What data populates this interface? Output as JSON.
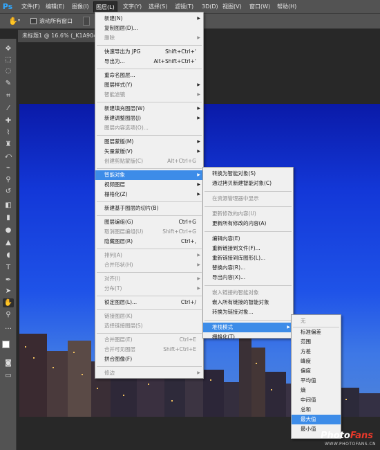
{
  "app": {
    "logo": "Ps"
  },
  "menubar": [
    {
      "label": "文件(F)"
    },
    {
      "label": "编辑(E)"
    },
    {
      "label": "图像(I)"
    },
    {
      "label": "图层(L)"
    },
    {
      "label": "文字(Y)"
    },
    {
      "label": "选择(S)"
    },
    {
      "label": "滤镜(T)"
    },
    {
      "label": "3D(D)"
    },
    {
      "label": "视图(V)"
    },
    {
      "label": "窗口(W)"
    },
    {
      "label": "帮助(H)"
    }
  ],
  "optionsbar": {
    "scroll_all_label": "滚动所有窗口"
  },
  "document": {
    "tab_title": "未标题1 @ 16.6% (_K1A904"
  },
  "layer_menu": [
    {
      "label": "新建(N)",
      "sub": true
    },
    {
      "label": "复制图层(D)..."
    },
    {
      "label": "删除",
      "sub": true,
      "disabled": true
    },
    {
      "sep": true
    },
    {
      "label": "快速导出为 JPG",
      "shortcut": "Shift+Ctrl+'"
    },
    {
      "label": "导出为...",
      "shortcut": "Alt+Shift+Ctrl+'"
    },
    {
      "sep": true
    },
    {
      "label": "重命名图层..."
    },
    {
      "label": "图层样式(Y)",
      "sub": true
    },
    {
      "label": "智能滤镜",
      "sub": true,
      "disabled": true
    },
    {
      "sep": true
    },
    {
      "label": "新建填充图层(W)",
      "sub": true
    },
    {
      "label": "新建调整图层(J)",
      "sub": true
    },
    {
      "label": "图层内容选项(O)...",
      "disabled": true
    },
    {
      "sep": true
    },
    {
      "label": "图层蒙版(M)",
      "sub": true
    },
    {
      "label": "矢量蒙版(V)",
      "sub": true
    },
    {
      "label": "创建剪贴蒙版(C)",
      "shortcut": "Alt+Ctrl+G",
      "disabled": true
    },
    {
      "sep": true
    },
    {
      "label": "智能对象",
      "sub": true,
      "highlighted": true
    },
    {
      "label": "视频图层",
      "sub": true
    },
    {
      "label": "栅格化(Z)",
      "sub": true
    },
    {
      "sep": true
    },
    {
      "label": "新建基于图层的切片(B)"
    },
    {
      "sep": true
    },
    {
      "label": "图层编组(G)",
      "shortcut": "Ctrl+G"
    },
    {
      "label": "取消图层编组(U)",
      "shortcut": "Shift+Ctrl+G",
      "disabled": true
    },
    {
      "label": "隐藏图层(R)",
      "shortcut": "Ctrl+,"
    },
    {
      "sep": true
    },
    {
      "label": "排列(A)",
      "sub": true,
      "disabled": true
    },
    {
      "label": "合并形状(H)",
      "sub": true,
      "disabled": true
    },
    {
      "sep": true
    },
    {
      "label": "对齐(I)",
      "sub": true,
      "disabled": true
    },
    {
      "label": "分布(T)",
      "sub": true,
      "disabled": true
    },
    {
      "sep": true
    },
    {
      "label": "锁定图层(L)...",
      "shortcut": "Ctrl+/"
    },
    {
      "sep": true
    },
    {
      "label": "链接图层(K)",
      "disabled": true
    },
    {
      "label": "选择链接图层(S)",
      "disabled": true
    },
    {
      "sep": true
    },
    {
      "label": "合并图层(E)",
      "shortcut": "Ctrl+E",
      "disabled": true
    },
    {
      "label": "合并可见图层",
      "shortcut": "Shift+Ctrl+E",
      "disabled": true
    },
    {
      "label": "拼合图像(F)"
    },
    {
      "sep": true
    },
    {
      "label": "修边",
      "sub": true,
      "disabled": true
    }
  ],
  "smart_object_menu": [
    {
      "label": "转换为智能对象(S)"
    },
    {
      "label": "通过拷贝新建智能对象(C)"
    },
    {
      "sep": true
    },
    {
      "label": "在资源管理器中显示",
      "disabled": true
    },
    {
      "sep": true
    },
    {
      "label": "更新修改的内容(U)",
      "disabled": true
    },
    {
      "label": "更新所有修改的内容(A)"
    },
    {
      "sep": true
    },
    {
      "label": "编辑内容(E)"
    },
    {
      "label": "重新链接到文件(F)..."
    },
    {
      "label": "重新链接到库图形(L)..."
    },
    {
      "label": "替换内容(R)..."
    },
    {
      "label": "导出内容(X)..."
    },
    {
      "sep": true
    },
    {
      "label": "嵌入链接的智能对象",
      "disabled": true
    },
    {
      "label": "嵌入所有链接的智能对象"
    },
    {
      "label": "转换为链接对象..."
    },
    {
      "sep": true
    },
    {
      "label": "堆栈模式",
      "sub": true,
      "highlighted": true
    },
    {
      "label": "栅格化(T)"
    }
  ],
  "stack_mode_menu": [
    {
      "label": "无",
      "disabled": true
    },
    {
      "sep": true
    },
    {
      "label": "标准偏差"
    },
    {
      "label": "范围"
    },
    {
      "label": "方差"
    },
    {
      "label": "峰度"
    },
    {
      "label": "偏度"
    },
    {
      "label": "平均值"
    },
    {
      "label": "熵"
    },
    {
      "label": "中间值"
    },
    {
      "label": "总和"
    },
    {
      "label": "最大值",
      "highlighted": true
    },
    {
      "label": "最小值"
    }
  ],
  "watermark": {
    "photo": "Photo",
    "fans": "Fans",
    "url": "WWW.PHOTOFANS.CN"
  },
  "colors": {
    "highlight": "#3d8ce8",
    "menu_bg": "#f0f0f0",
    "ui_dark": "#535353",
    "sky_top": "#0a1aa8"
  }
}
